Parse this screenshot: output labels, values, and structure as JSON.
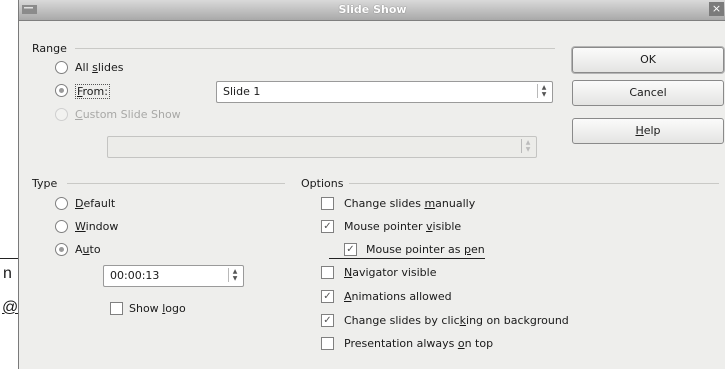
{
  "window": {
    "title": "Slide Show",
    "close_glyph": "×"
  },
  "range": {
    "label": "Range",
    "all_slides": {
      "pre": "All ",
      "u": "s",
      "post": "lides"
    },
    "from": {
      "pre": "",
      "u": "F",
      "post": "rom:"
    },
    "from_value": "Slide 1",
    "custom": {
      "pre": "",
      "u": "C",
      "post": "ustom Slide Show"
    }
  },
  "type": {
    "label": "Type",
    "default": {
      "pre": "",
      "u": "D",
      "post": "efault"
    },
    "window": {
      "pre": "",
      "u": "W",
      "post": "indow"
    },
    "auto": {
      "pre": "A",
      "u": "u",
      "post": "to"
    },
    "time_value": "00:00:13",
    "show_logo": {
      "pre": "Show ",
      "u": "l",
      "post": "ogo"
    }
  },
  "options": {
    "label": "Options",
    "change_manually": {
      "pre": "Change slides ",
      "u": "m",
      "post": "anually"
    },
    "pointer_visible": {
      "pre": "Mouse pointer ",
      "u": "v",
      "post": "isible"
    },
    "pointer_pen": {
      "pre": "Mouse pointer as ",
      "u": "p",
      "post": "en"
    },
    "navigator": {
      "pre": "",
      "u": "N",
      "post": "avigator visible"
    },
    "animations": {
      "pre": "",
      "u": "A",
      "post": "nimations allowed"
    },
    "change_click": {
      "pre": "Change slides by clic",
      "u": "k",
      "post": "ing on background"
    },
    "always_top": {
      "pre": "Presentation always ",
      "u": "o",
      "post": "n top"
    }
  },
  "buttons": {
    "ok": "OK",
    "cancel": "Cancel",
    "help": {
      "pre": "",
      "u": "H",
      "post": "elp"
    }
  },
  "behind_window": {
    "n": "n",
    "at": "@"
  },
  "state": {
    "range_selected": "from",
    "type_selected": "auto",
    "checkbox_checked": {
      "show_logo": false,
      "change_manually": false,
      "pointer_visible": true,
      "pointer_pen": true,
      "navigator": false,
      "animations": true,
      "change_click": true,
      "always_top": false
    }
  }
}
